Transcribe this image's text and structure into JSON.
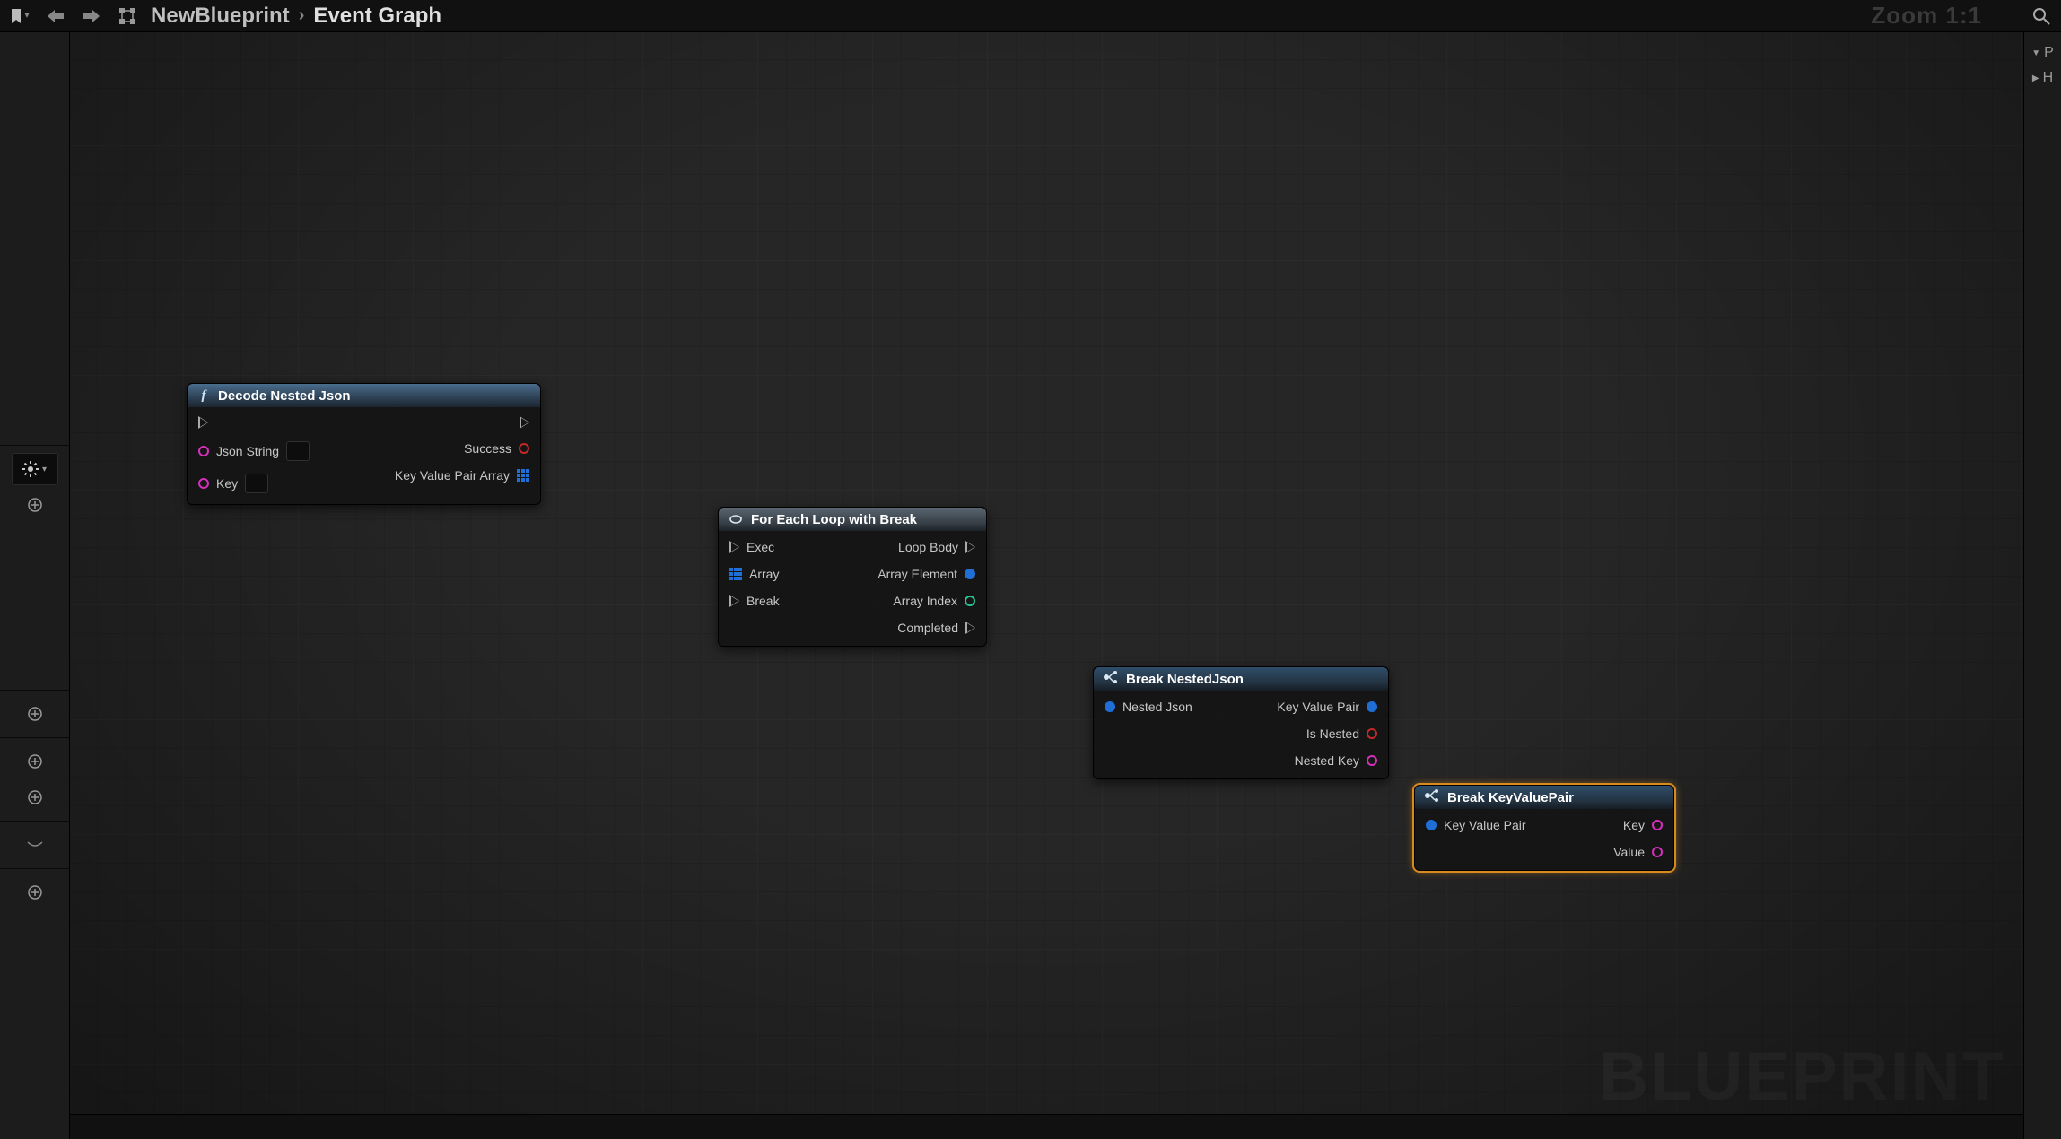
{
  "topbar": {
    "breadcrumb_a": "NewBlueprint",
    "breadcrumb_b": "Event Graph",
    "zoom": "Zoom 1:1"
  },
  "rightrail": {
    "letter_p": "P",
    "letter_h": "H"
  },
  "watermark": "BLUEPRINT",
  "bottombar": {},
  "nodes": {
    "decode": {
      "title": "Decode Nested Json",
      "in_jsonstring": "Json String",
      "in_key": "Key",
      "out_success": "Success",
      "out_array": "Key Value Pair Array"
    },
    "foreach": {
      "title": "For Each Loop with Break",
      "in_exec": "Exec",
      "in_array": "Array",
      "in_break": "Break",
      "out_body": "Loop Body",
      "out_elem": "Array Element",
      "out_index": "Array Index",
      "out_completed": "Completed"
    },
    "breaknested": {
      "title": "Break NestedJson",
      "in_nested": "Nested Json",
      "out_kvp": "Key Value Pair",
      "out_isnested": "Is Nested",
      "out_nestedkey": "Nested Key"
    },
    "breakkvp": {
      "title": "Break KeyValuePair",
      "in_kvp": "Key Value Pair",
      "out_key": "Key",
      "out_value": "Value"
    }
  }
}
